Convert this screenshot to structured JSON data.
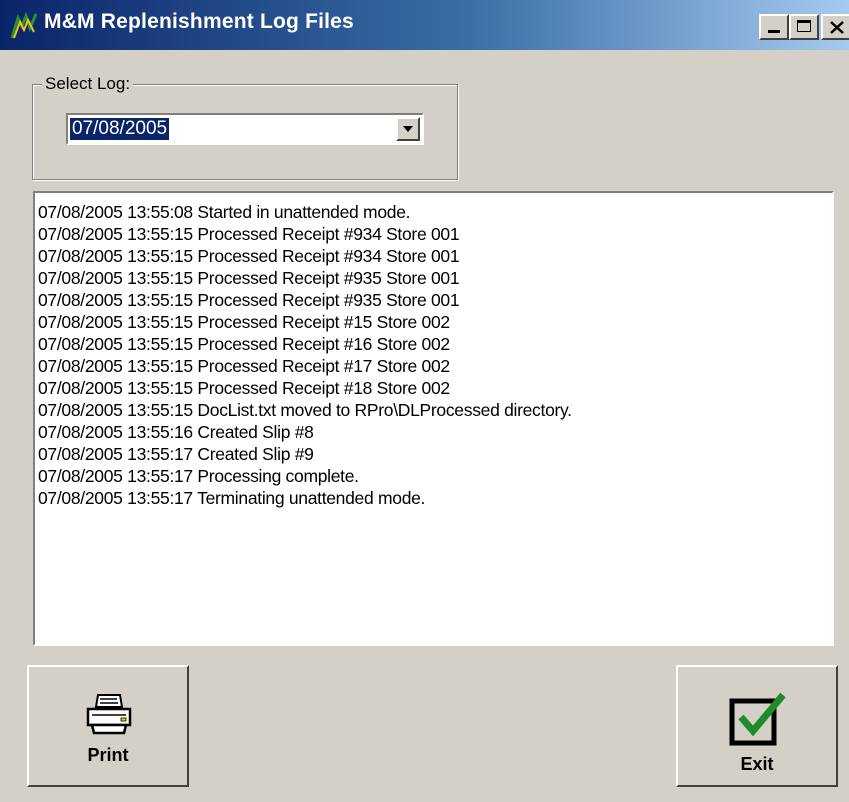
{
  "window": {
    "title": "M&M Replenishment  Log Files"
  },
  "select_log": {
    "label": "Select Log:",
    "selected_value": "07/08/2005"
  },
  "log_entries": [
    "07/08/2005 13:55:08 Started in unattended mode.",
    "07/08/2005 13:55:15 Processed Receipt #934 Store 001",
    "07/08/2005 13:55:15 Processed Receipt #934 Store 001",
    "07/08/2005 13:55:15 Processed Receipt #935 Store 001",
    "07/08/2005 13:55:15 Processed Receipt #935 Store 001",
    "07/08/2005 13:55:15 Processed Receipt #15 Store 002",
    "07/08/2005 13:55:15 Processed Receipt #16 Store 002",
    "07/08/2005 13:55:15 Processed Receipt #17 Store 002",
    "07/08/2005 13:55:15 Processed Receipt #18 Store 002",
    "07/08/2005 13:55:15 DocList.txt moved to RPro\\DLProcessed directory.",
    "07/08/2005 13:55:16 Created Slip #8",
    "07/08/2005 13:55:17 Created Slip #9",
    "07/08/2005 13:55:17 Processing complete.",
    "07/08/2005 13:55:17 Terminating unattended mode."
  ],
  "buttons": {
    "print_label": "Print",
    "exit_label": "Exit"
  },
  "icons": {
    "app": "app-logo-icon",
    "print": "printer-icon",
    "exit": "checkmark-icon",
    "dropdown": "chevron-down-icon"
  },
  "colors": {
    "titlebar_start": "#0a246a",
    "titlebar_end": "#a6caf0",
    "window_face": "#d4d0c8",
    "selection": "#0a246a",
    "checkmark": "#1e8c2a"
  }
}
